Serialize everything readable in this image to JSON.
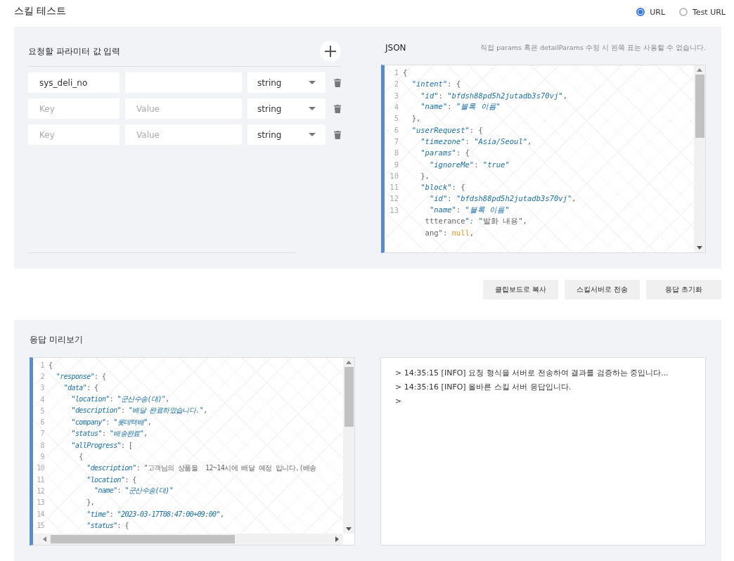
{
  "page_title": "스킬 테스트",
  "url_options": [
    {
      "label": "URL",
      "selected": true
    },
    {
      "label": "Test URL",
      "selected": false
    }
  ],
  "params": {
    "title": "요청할 파라미터 값 입력",
    "rows": [
      {
        "key": "sys_deli_no",
        "type": "string"
      },
      {
        "key_placeholder": "Key",
        "value_placeholder": "Value",
        "type": "string"
      },
      {
        "key_placeholder": "Key",
        "value_placeholder": "Value",
        "type": "string"
      }
    ]
  },
  "json_panel": {
    "title": "JSON",
    "hint": "직접 params 혹은 detailParams 수정 시 왼쪽 표는 사용할 수 없습니다.",
    "lines": [
      {
        "num": "1",
        "text": "{"
      },
      {
        "num": "2",
        "text": "  \"intent\": {"
      },
      {
        "num": "3",
        "text": "    \"id\": \"bfdsh88pd5h2jutadb3s70vj\","
      },
      {
        "num": "4",
        "text": "    \"name\": \"블록 이름\""
      },
      {
        "num": "5",
        "text": "  },"
      },
      {
        "num": "6",
        "text": "  \"userRequest\": {"
      },
      {
        "num": "7",
        "text": "    \"timezone\": \"Asia/Seoul\","
      },
      {
        "num": "8",
        "text": "    \"params\": {"
      },
      {
        "num": "9",
        "text": "      \"ignoreMe\": \"true\""
      },
      {
        "num": "10",
        "text": "    },"
      },
      {
        "num": "11",
        "text": "    \"block\": {"
      },
      {
        "num": "12",
        "text": "      \"id\": \"bfdsh88pd5h2jutadb3s70vj\","
      },
      {
        "num": "13",
        "text": "      \"name\": \"블록 이름\""
      },
      {
        "text": "     ttterance\": \"발화 내용\","
      },
      {
        "text": "     ang\": null,"
      }
    ]
  },
  "buttons": [
    "클립보드로 복사",
    "스킬서버로 전송",
    "응답 초기화"
  ],
  "preview": {
    "title": "응답 미리보기",
    "lines": [
      {
        "num": "1",
        "text": "{"
      },
      {
        "num": "2",
        "text": "  \"response\": {"
      },
      {
        "num": "3",
        "text": "    \"data\": {"
      },
      {
        "num": "4",
        "text": "      \"location\": \"군산수송(대)\","
      },
      {
        "num": "5",
        "text": "      \"description\": \"배달 완료하였습니다.\","
      },
      {
        "num": "6",
        "text": "      \"company\": \"롯데택배\","
      },
      {
        "num": "7",
        "text": "      \"status\": \"배송완료\","
      },
      {
        "num": "8",
        "text": "      \"allProgress\": ["
      },
      {
        "num": "9",
        "text": "        {"
      },
      {
        "num": "10",
        "text": "          \"description\": \"고객님의 상품을  12~14시에 배달 예정 입니다.(배송"
      },
      {
        "num": "11",
        "text": "          \"location\": {"
      },
      {
        "num": "12",
        "text": "            \"name\": \"군산수송(대)\""
      },
      {
        "num": "13",
        "text": "          },"
      },
      {
        "num": "14",
        "text": "          \"time\": \"2023-03-17T08:47:00+09:00\","
      },
      {
        "num": "15",
        "text": "          \"status\": {"
      }
    ]
  },
  "console": {
    "lines": [
      "> 14:35:15 [INFO] 요청 형식을 서버로 전송하여 결과를 검증하는 중입니다...",
      "> 14:35:16 [INFO] 올바른 스킬 서버 응답입니다.",
      ">"
    ]
  }
}
